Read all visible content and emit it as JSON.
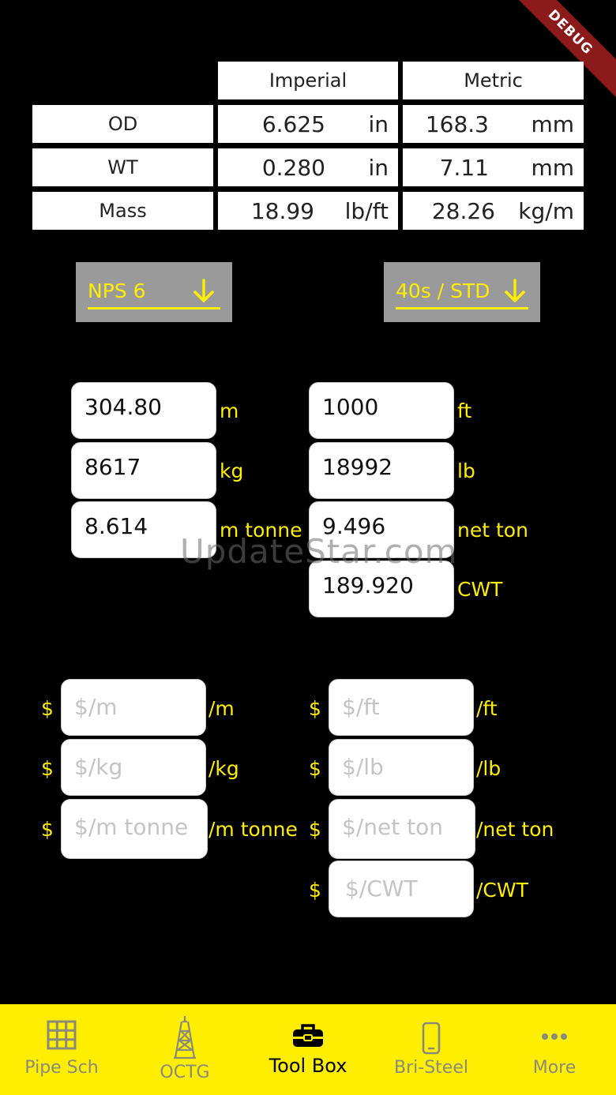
{
  "debug_banner": "DEBUG",
  "specs": {
    "headers": [
      "Imperial",
      "Metric"
    ],
    "rows": [
      {
        "label": "OD",
        "imperial_value": "6.625",
        "imperial_unit": "in",
        "metric_value": "168.3",
        "metric_unit": "mm"
      },
      {
        "label": "WT",
        "imperial_value": "0.280",
        "imperial_unit": "in",
        "metric_value": "7.11",
        "metric_unit": "mm"
      },
      {
        "label": "Mass",
        "imperial_value": "18.99",
        "imperial_unit": "lb/ft",
        "metric_value": "28.26",
        "metric_unit": "kg/m"
      }
    ]
  },
  "selectors": {
    "size": "NPS 6",
    "schedule": "40s / STD"
  },
  "metric_fields": [
    {
      "value": "304.80",
      "unit": "m"
    },
    {
      "value": "8617",
      "unit": "kg"
    },
    {
      "value": "8.614",
      "unit": "m tonne"
    }
  ],
  "imperial_fields": [
    {
      "value": "1000",
      "unit": "ft"
    },
    {
      "value": "18992",
      "unit": "lb"
    },
    {
      "value": "9.496",
      "unit": "net ton"
    },
    {
      "value": "189.920",
      "unit": "CWT"
    }
  ],
  "metric_prices": [
    {
      "currency": "$",
      "placeholder": "$/m",
      "unit": "/m"
    },
    {
      "currency": "$",
      "placeholder": "$/kg",
      "unit": "/kg"
    },
    {
      "currency": "$",
      "placeholder": "$/m tonne",
      "unit": "/m tonne"
    }
  ],
  "imperial_prices": [
    {
      "currency": "$",
      "placeholder": "$/ft",
      "unit": "/ft"
    },
    {
      "currency": "$",
      "placeholder": "$/lb",
      "unit": "/lb"
    },
    {
      "currency": "$",
      "placeholder": "$/net ton",
      "unit": "/net ton"
    },
    {
      "currency": "$",
      "placeholder": "$/CWT",
      "unit": "/CWT"
    }
  ],
  "watermark": "UpdateStar.com",
  "tabs": [
    {
      "label": "Pipe Sch",
      "icon": "grid-icon",
      "active": false
    },
    {
      "label": "OCTG",
      "icon": "oil-rig-icon",
      "active": false
    },
    {
      "label": "Tool Box",
      "icon": "toolbox-icon",
      "active": true
    },
    {
      "label": "Bri-Steel",
      "icon": "phone-icon",
      "active": false
    },
    {
      "label": "More",
      "icon": "more-dots-icon",
      "active": false
    }
  ],
  "colors": {
    "accent": "#ffee00",
    "background": "#000000",
    "dropdown": "#9a9a9a",
    "banner": "#8b1a1a"
  }
}
